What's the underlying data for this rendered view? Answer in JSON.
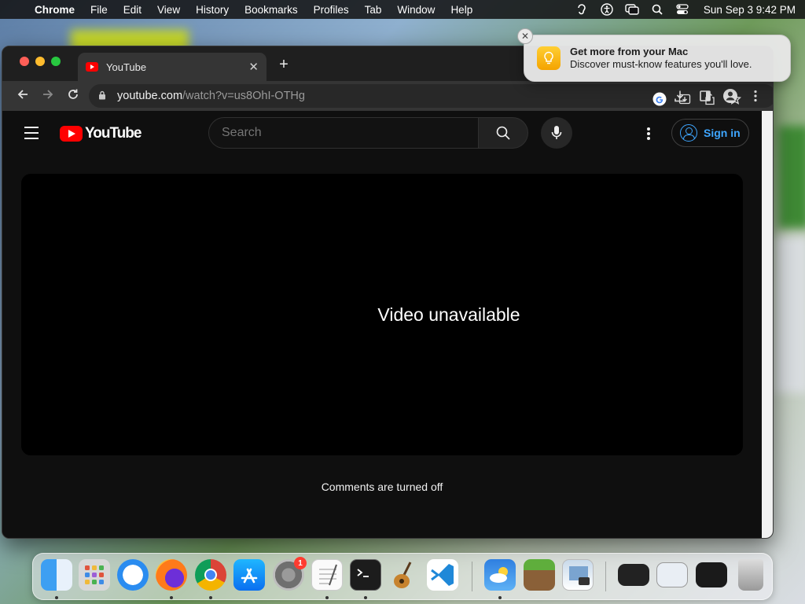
{
  "menubar": {
    "app": "Chrome",
    "items": [
      "File",
      "Edit",
      "View",
      "History",
      "Bookmarks",
      "Profiles",
      "Tab",
      "Window",
      "Help"
    ],
    "clock": "Sun Sep 3  9:42 PM",
    "status_icons": [
      "hearing-icon",
      "accessibility-icon",
      "screen-mirroring-icon",
      "spotlight-search-icon",
      "control-center-icon"
    ]
  },
  "notification": {
    "title": "Get more from your Mac",
    "body": "Discover must-know features you'll love.",
    "icon": "tips-lightbulb-icon",
    "close": "✕"
  },
  "browser": {
    "tab_title": "YouTube",
    "tab_close": "✕",
    "new_tab": "+",
    "url_host": "youtube.com",
    "url_path": "/watch?v=us8OhI-OTHg"
  },
  "youtube": {
    "logo_text": "YouTube",
    "search_placeholder": "Search",
    "sign_in": "Sign in",
    "player_message": "Video unavailable",
    "comments_message": "Comments are turned off",
    "colors": {
      "accent": "#ff0000",
      "link": "#3ea6ff",
      "background": "#0f0f0f"
    }
  },
  "dock": {
    "apps": [
      "Finder",
      "Launchpad",
      "Safari",
      "Firefox",
      "Chrome",
      "App Store",
      "System Settings",
      "TextEdit",
      "Terminal",
      "GarageBand",
      "Visual Studio Code",
      "Weather",
      "Minecraft",
      "Preview"
    ],
    "settings_badge": "1",
    "recent": [
      "window-1",
      "window-2",
      "window-3"
    ],
    "trash": "Trash"
  }
}
